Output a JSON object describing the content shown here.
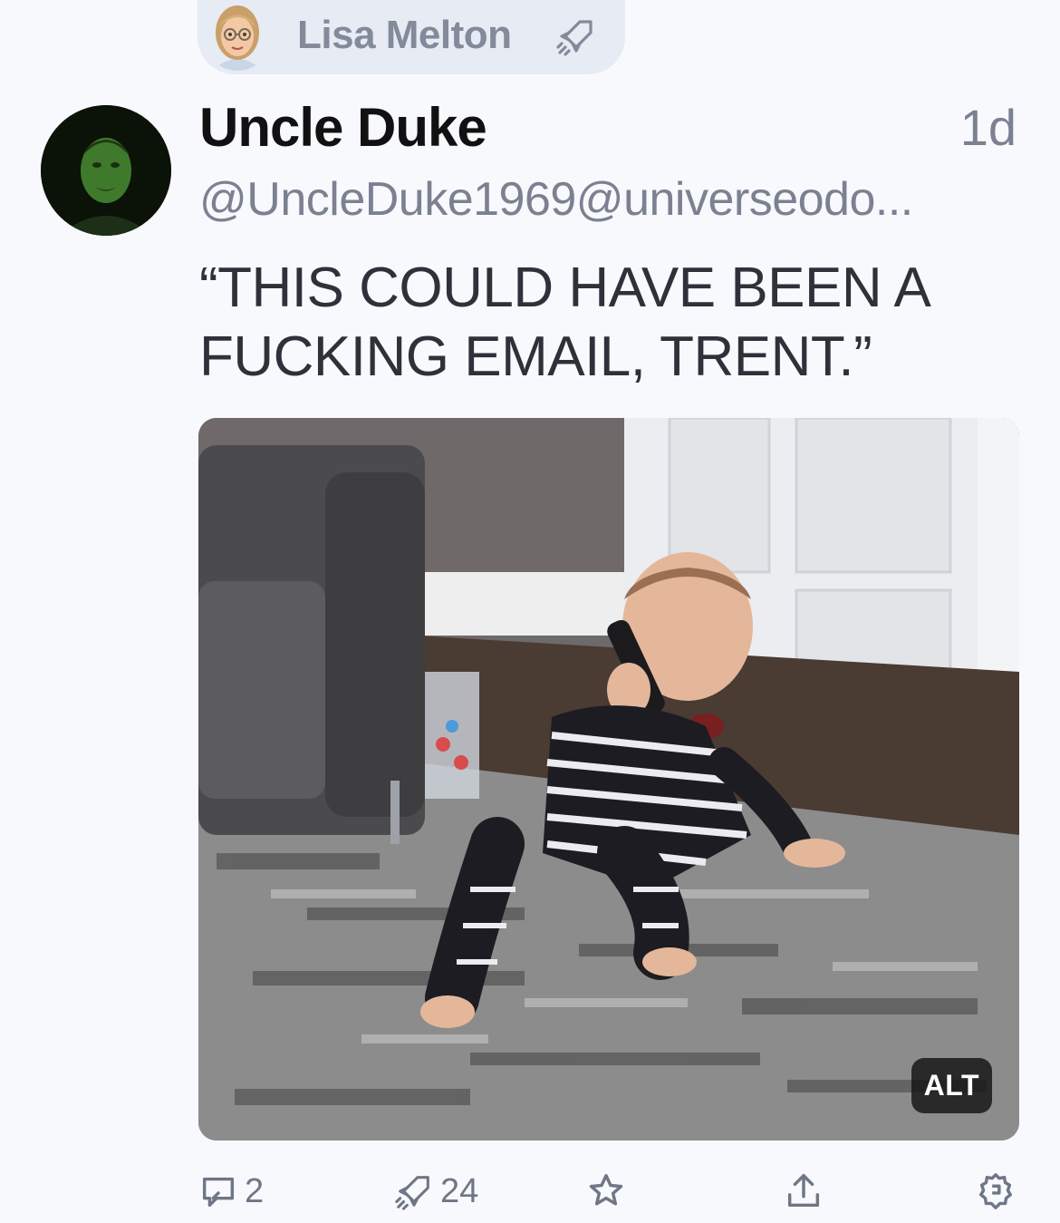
{
  "booster": {
    "name": "Lisa Melton",
    "boost_icon": "rocket-icon"
  },
  "post": {
    "display_name": "Uncle Duke",
    "time": "1d",
    "handle": "@UncleDuke1969@universeodo...",
    "content_line1": "“THIS COULD HAVE BEEN A",
    "content_line2": "FUCKING EMAIL, TRENT.”",
    "media_alt_badge": "ALT"
  },
  "actions": {
    "replies_count": "2",
    "boosts_count": "24",
    "reply_icon": "reply-bubble-icon",
    "boost_icon": "rocket-icon",
    "favorite_icon": "star-icon",
    "share_icon": "share-upload-icon",
    "settings_icon": "gear-icon"
  },
  "colors": {
    "background": "#f7f9fd",
    "pill": "#e7ebf3",
    "muted_text": "#7b8191",
    "primary_text": "#111111"
  }
}
